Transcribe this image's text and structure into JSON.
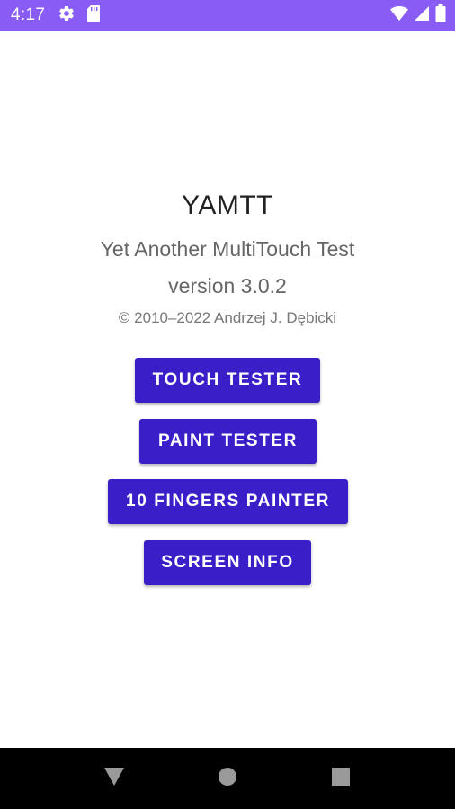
{
  "status_bar": {
    "time": "4:17",
    "bg_color": "#8a5cf6",
    "icons": [
      "gear-icon",
      "sd-card-icon",
      "wifi-icon",
      "signal-icon",
      "battery-icon"
    ]
  },
  "app": {
    "title": "YAMTT",
    "subtitle": "Yet Another MultiTouch Test",
    "version": "version 3.0.2",
    "copyright": "© 2010–2022 Andrzej J. Dębicki",
    "accent_color": "#3a1fc9"
  },
  "buttons": {
    "touch_tester": "TOUCH TESTER",
    "paint_tester": "PAINT TESTER",
    "fingers_painter": "10 FINGERS PAINTER",
    "screen_info": "SCREEN INFO"
  },
  "nav_bar": {
    "icons": [
      "back-icon",
      "home-icon",
      "recents-icon"
    ]
  }
}
